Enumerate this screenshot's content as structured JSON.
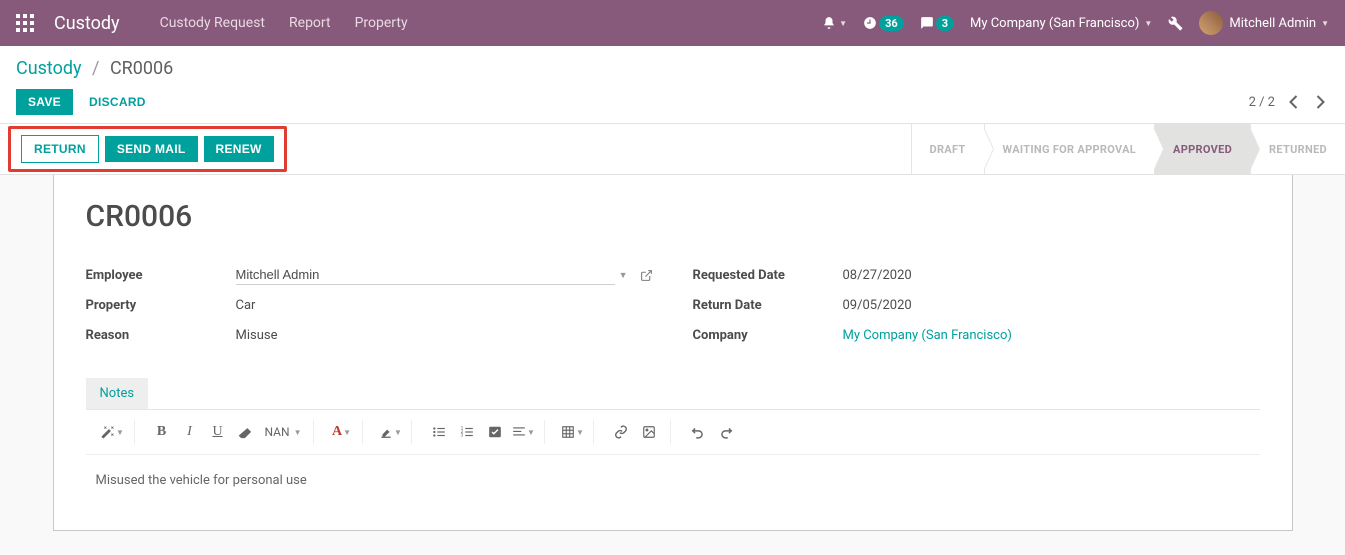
{
  "navbar": {
    "brand": "Custody",
    "menu": [
      "Custody Request",
      "Report",
      "Property"
    ],
    "activity_count": "36",
    "messages_count": "3",
    "company": "My Company (San Francisco)",
    "user": "Mitchell Admin"
  },
  "breadcrumb": {
    "parent": "Custody",
    "current": "CR0006"
  },
  "cp": {
    "save": "SAVE",
    "discard": "DISCARD",
    "pager": "2 / 2"
  },
  "status_buttons": {
    "return": "RETURN",
    "send_mail": "SEND MAIL",
    "renew": "RENEW"
  },
  "stages": [
    "DRAFT",
    "WAITING FOR APPROVAL",
    "APPROVED",
    "RETURNED"
  ],
  "record": {
    "name": "CR0006",
    "labels": {
      "employee": "Employee",
      "property": "Property",
      "reason": "Reason",
      "requested_date": "Requested Date",
      "return_date": "Return Date",
      "company": "Company"
    },
    "employee": "Mitchell Admin",
    "property": "Car",
    "reason": "Misuse",
    "requested_date": "08/27/2020",
    "return_date": "09/05/2020",
    "company": "My Company (San Francisco)"
  },
  "notebook": {
    "tab": "Notes",
    "font_label": "NAN",
    "body": "Misused the vehicle for personal use"
  }
}
